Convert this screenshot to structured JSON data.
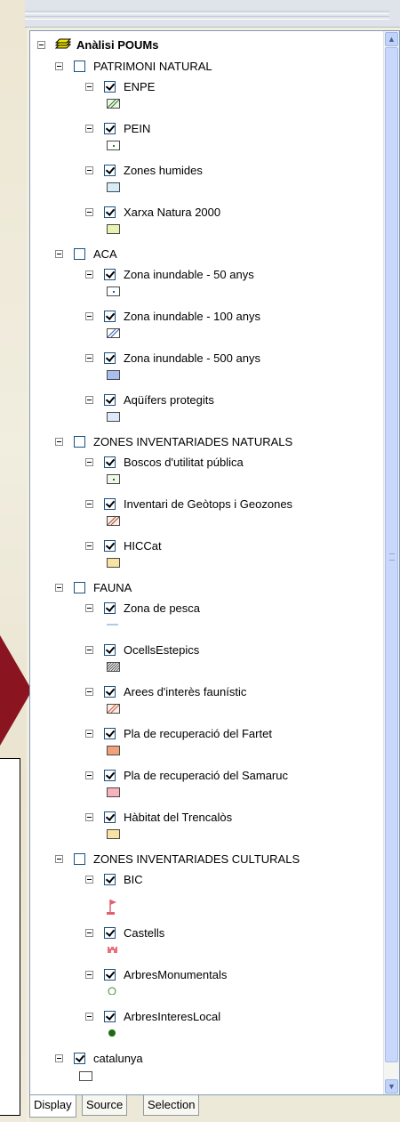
{
  "root": {
    "label": "Anàlisi POUMs",
    "icon": "layers-icon"
  },
  "groups": [
    {
      "label": "PATRIMONI NATURAL",
      "checked": false,
      "layers": [
        {
          "label": "ENPE",
          "checked": true,
          "symbol": "hatch-green"
        },
        {
          "label": "PEIN",
          "checked": true,
          "symbol": "dot-green"
        },
        {
          "label": "Zones humides",
          "checked": true,
          "symbol": "fill-lightblue"
        },
        {
          "label": "Xarxa Natura 2000",
          "checked": true,
          "symbol": "fill-lightgreen"
        }
      ]
    },
    {
      "label": "ACA",
      "checked": false,
      "layers": [
        {
          "label": "Zona inundable - 50 anys",
          "checked": true,
          "symbol": "dot-blue"
        },
        {
          "label": "Zona inundable - 100 anys",
          "checked": true,
          "symbol": "hatch-blue"
        },
        {
          "label": "Zona inundable - 500 anys",
          "checked": true,
          "symbol": "fill-blue"
        },
        {
          "label": "Aqüífers protegits",
          "checked": true,
          "symbol": "fill-paleblue"
        }
      ]
    },
    {
      "label": "ZONES INVENTARIADES NATURALS",
      "checked": false,
      "layers": [
        {
          "label": "Boscos d'utilitat pública",
          "checked": true,
          "symbol": "dot-darkgreen"
        },
        {
          "label": "Inventari de Geòtops i Geozones",
          "checked": true,
          "symbol": "hatch-brown"
        },
        {
          "label": "HICCat",
          "checked": true,
          "symbol": "fill-sand"
        }
      ]
    },
    {
      "label": "FAUNA",
      "checked": false,
      "layers": [
        {
          "label": "Zona de pesca",
          "checked": true,
          "symbol": "line-blue"
        },
        {
          "label": "OcellsEstepics",
          "checked": true,
          "symbol": "hatch-dense"
        },
        {
          "label": "Arees d'interès faunístic",
          "checked": true,
          "symbol": "hatch-orange"
        },
        {
          "label": "Pla de recuperació del Fartet",
          "checked": true,
          "symbol": "fill-salmon"
        },
        {
          "label": "Pla de recuperació del Samaruc",
          "checked": true,
          "symbol": "fill-pink"
        },
        {
          "label": "Hàbitat del Trencalòs",
          "checked": true,
          "symbol": "fill-sand"
        }
      ]
    },
    {
      "label": "ZONES INVENTARIADES CULTURALS",
      "checked": false,
      "layers": [
        {
          "label": "BIC",
          "checked": true,
          "symbol": "flag-icon"
        },
        {
          "label": "Castells",
          "checked": true,
          "symbol": "castle-icon"
        },
        {
          "label": "ArbresMonumentals",
          "checked": true,
          "symbol": "tree-outline-icon"
        },
        {
          "label": "ArbresInteresLocal",
          "checked": true,
          "symbol": "tree-filled-icon"
        }
      ]
    }
  ],
  "extra_layer": {
    "label": "catalunya",
    "checked": true,
    "symbol": "fill-white"
  },
  "tabs": [
    {
      "label": "Display",
      "active": true
    },
    {
      "label": "Source",
      "active": false
    },
    {
      "label": "Selection",
      "active": false
    }
  ],
  "scrollbar": {
    "up_icon": "scroll-up-icon",
    "down_icon": "scroll-down-icon"
  },
  "colors": {
    "panel_border": "#7f9db9",
    "scroll_thumb": "#c8d7fb",
    "arrow": "#8a1420"
  }
}
